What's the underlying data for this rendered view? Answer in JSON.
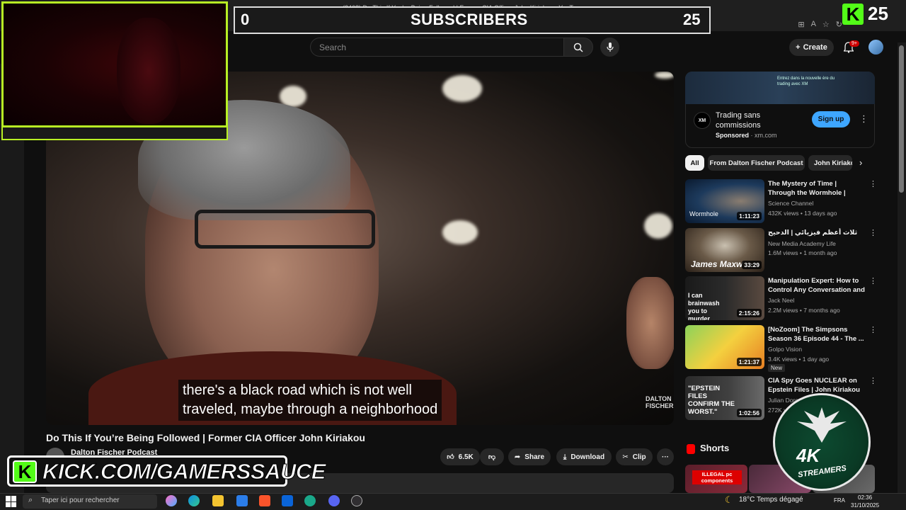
{
  "browser": {
    "tab_title": "(2468) Do This If You're Being Followed | Former CIA Officer John Kiriakou - YouTube"
  },
  "header": {
    "search_placeholder": "Search",
    "create_label": "Create",
    "notification_badge": "9+"
  },
  "overlay": {
    "sub_left": "0",
    "sub_title": "SUBSCRIBERS",
    "sub_right": "25",
    "kick_count": "25",
    "kick_k": "K",
    "kick_url": "KICK.COM/GAMERSSAUCE",
    "emblem_text": "4K",
    "emblem_sub": "STREAMERS"
  },
  "video": {
    "subtitle_line1": "there's a black road which is not well",
    "subtitle_line2": "traveled, maybe through a neighborhood",
    "watermark": "DALTON FISCHER",
    "title": "Do This If You’re Being Followed | Former CIA Officer John Kiriakou",
    "channel": "Dalton Fischer Podcast",
    "likes": "6.5K",
    "share_label": "Share",
    "download_label": "Download",
    "clip_label": "Clip",
    "more_label": "···"
  },
  "ad": {
    "banner_text": "Entrez dans la nouvelle ère du trading avec XM",
    "logo": "XM",
    "title": "Trading sans commissions",
    "sponsored": "Sponsored",
    "domain": "xm.com",
    "cta": "Sign up"
  },
  "chips": [
    "All",
    "From Dalton Fischer Podcast",
    "John Kiriakou"
  ],
  "recommendations": [
    {
      "title": "The Mystery of Time | Through the Wormhole | Science Channel",
      "channel": "Science Channel",
      "meta": "432K views • 13 days ago",
      "duration": "1:11:23",
      "thumb_color": "#1d3a5c"
    },
    {
      "title": "ثلاث أعظم فيزيائي | الدحيح",
      "channel": "New Media Academy Life",
      "meta": "1.6M views • 1 month ago",
      "duration": "33:29",
      "thumb_color": "#4a3b2a",
      "thumb_label": "James Maxw"
    },
    {
      "title": "Manipulation Expert: How to Control Any Conversation and ...",
      "channel": "Jack Neel",
      "meta": "2.2M views • 7 months ago",
      "duration": "2:15:26",
      "thumb_color": "#2a2a2a",
      "thumb_label": "I can brainwash you to murder"
    },
    {
      "title": "[NoZoom] The Simpsons Season 36 Episode 44 - The ...",
      "channel": "Golpo Vision",
      "meta": "3.4K views • 1 day ago",
      "duration": "1:21:37",
      "thumb_color": "#7ab84a",
      "badge": "New"
    },
    {
      "title": "CIA Spy Goes NUCLEAR on Epstein Files | John Kiriakou",
      "channel": "Julian Dorey",
      "meta": "272K views",
      "duration": "1:02:56",
      "thumb_color": "#3a3a3a",
      "thumb_label": "\"EPSTEIN FILES CONFIRM THE WORST.\""
    }
  ],
  "shorts": {
    "title": "Shorts",
    "first_label": "ILLEGAL pc components"
  },
  "taskbar": {
    "search_placeholder": "Taper ici pour rechercher",
    "weather": "18°C  Temps dégagé",
    "lang": "FRA",
    "time": "02:36",
    "date": "31/10/2025"
  },
  "colors": {
    "accent_blue": "#3ea6ff",
    "kick_green": "#53fc18",
    "webcam_border": "#b8f024",
    "youtube_red": "#ff0000"
  }
}
